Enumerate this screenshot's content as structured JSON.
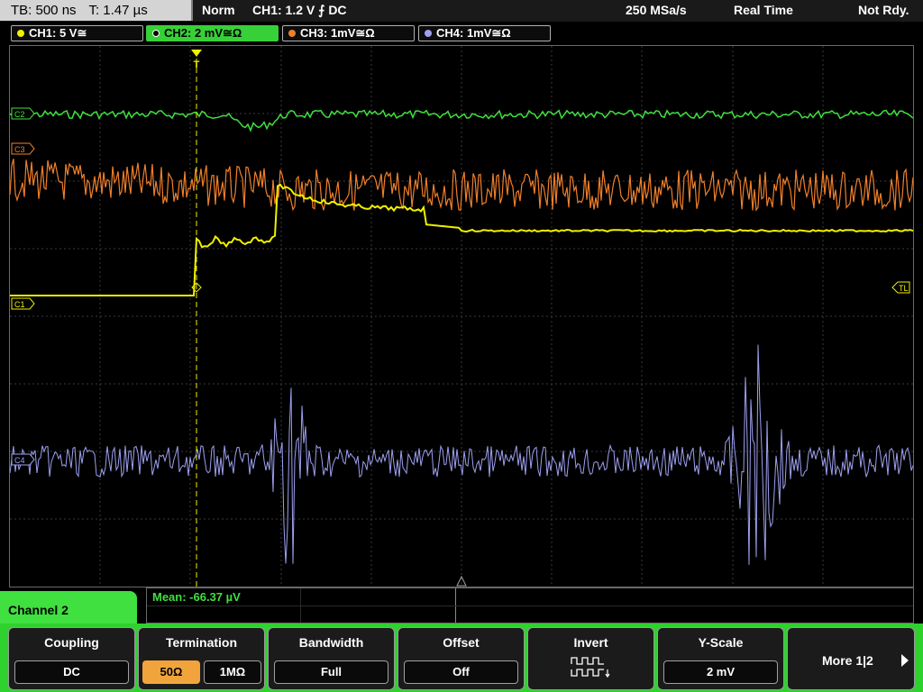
{
  "status_bar": {
    "timebase": "TB: 500 ns",
    "trigger_time": "T: 1.47 µs",
    "trigger_mode": "Norm",
    "trigger_setting": "CH1: 1.2 V ⨍ DC",
    "sample_rate": "250 MSa/s",
    "acq_mode": "Real Time",
    "status": "Not Rdy."
  },
  "channels": [
    {
      "label": "CH1: 5 V≅",
      "color": "#f0f000",
      "active": false
    },
    {
      "label": "CH2: 2 mV≅Ω",
      "color": "#3fe03f",
      "active": true
    },
    {
      "label": "CH3: 1mV≅Ω",
      "color": "#f07f2a",
      "active": false
    },
    {
      "label": "CH4: 1mV≅Ω",
      "color": "#9ea0f0",
      "active": false
    }
  ],
  "markers": {
    "c2": "C2",
    "c3": "C3",
    "c1": "C1",
    "c4": "C4",
    "trigger_level": "TL",
    "trigger_top": "T"
  },
  "measurement": {
    "text": "Mean: -66.37 µV"
  },
  "channel_menu": {
    "title": "Channel 2"
  },
  "softkeys": {
    "coupling": {
      "title": "Coupling",
      "value": "DC"
    },
    "termination": {
      "title": "Termination",
      "option_a": "50Ω",
      "option_b": "1MΩ"
    },
    "bandwidth": {
      "title": "Bandwidth",
      "value": "Full"
    },
    "offset": {
      "title": "Offset",
      "value": "Off"
    },
    "invert": {
      "title": "Invert",
      "icon": "invert-waveform-icon"
    },
    "yscale": {
      "title": "Y-Scale",
      "value": "2 mV"
    },
    "more": {
      "label": "More 1|2",
      "icon": "arrow-right-icon"
    }
  },
  "colors": {
    "ch1": "#f0f000",
    "ch2": "#3fe03f",
    "ch3": "#f07f2a",
    "ch4": "#9ea0f0",
    "grid": "#3a3a3a",
    "menu_green": "#2fd12f",
    "selected_option": "#f2a43c"
  }
}
